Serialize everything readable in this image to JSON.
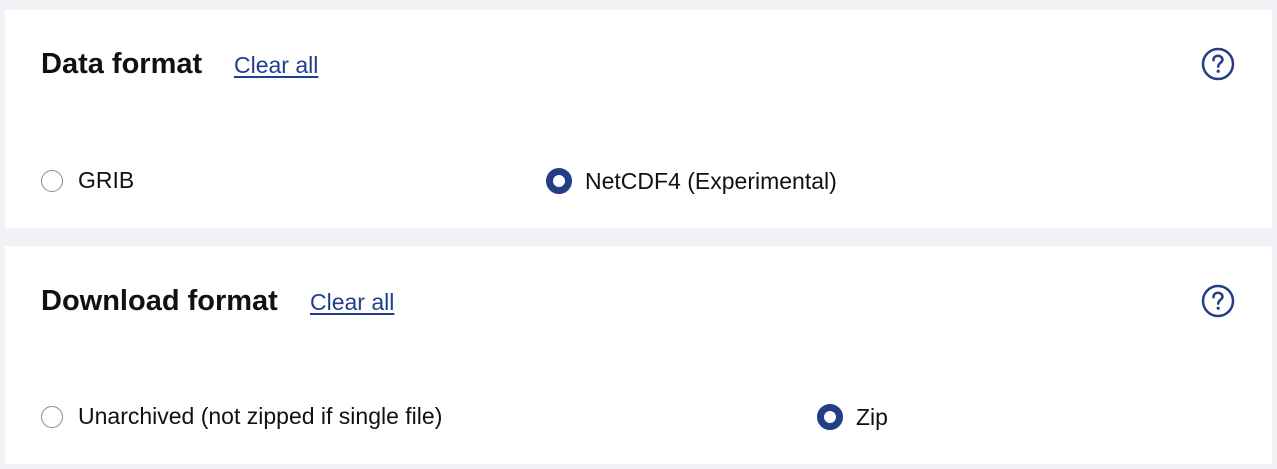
{
  "sections": [
    {
      "title": "Data format",
      "clear_label": "Clear all",
      "options": [
        {
          "label": "GRIB",
          "selected": false
        },
        {
          "label": "NetCDF4 (Experimental)",
          "selected": true
        }
      ]
    },
    {
      "title": "Download format",
      "clear_label": "Clear all",
      "options": [
        {
          "label": "Unarchived (not zipped if single file)",
          "selected": false
        },
        {
          "label": "Zip",
          "selected": true
        }
      ]
    }
  ],
  "colors": {
    "accent": "#233d86",
    "link": "#1f3f8e",
    "page_background": "#f1f2f6",
    "panel_background": "#ffffff"
  },
  "icons": {
    "help": "question-circle-icon"
  }
}
